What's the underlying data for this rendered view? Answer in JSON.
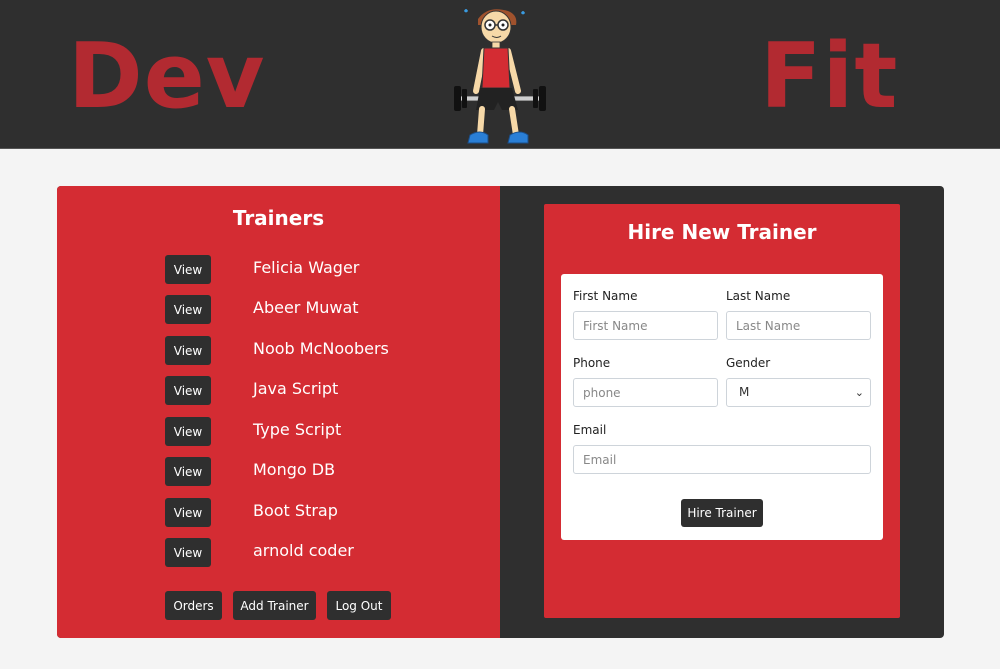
{
  "header": {
    "brand_left": "Dev",
    "brand_right": "Fit",
    "mascot_icon": "weightlifter-mascot-icon"
  },
  "trainers": {
    "title": "Trainers",
    "view_label": "View",
    "items": [
      {
        "name": "Felicia Wager"
      },
      {
        "name": "Abeer Muwat"
      },
      {
        "name": "Noob McNoobers"
      },
      {
        "name": "Java Script"
      },
      {
        "name": "Type Script"
      },
      {
        "name": "Mongo DB"
      },
      {
        "name": "Boot Strap"
      },
      {
        "name": "arnold coder"
      }
    ],
    "actions": {
      "orders": "Orders",
      "add_trainer": "Add Trainer",
      "log_out": "Log Out"
    }
  },
  "hire_form": {
    "title": "Hire New Trainer",
    "first_name": {
      "label": "First Name",
      "placeholder": "First Name",
      "value": ""
    },
    "last_name": {
      "label": "Last Name",
      "placeholder": "Last Name",
      "value": ""
    },
    "phone": {
      "label": "Phone",
      "placeholder": "phone",
      "value": ""
    },
    "gender": {
      "label": "Gender",
      "selected": "M"
    },
    "email": {
      "label": "Email",
      "placeholder": "Email",
      "value": ""
    },
    "submit_label": "Hire Trainer"
  },
  "colors": {
    "header_bg": "#2f2f2f",
    "brand": "#b22a31",
    "panel_red": "#d42c33",
    "dark": "#2f2f2f",
    "page_bg": "#f4f4f4"
  }
}
